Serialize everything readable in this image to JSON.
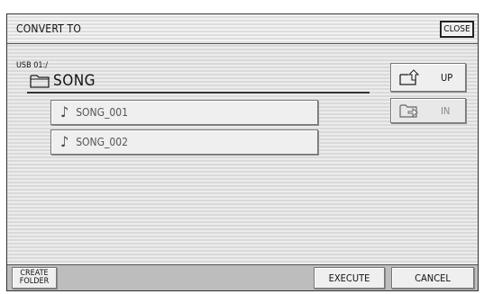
{
  "header": {
    "title": "CONVERT TO",
    "close_label": "CLOSE"
  },
  "location": {
    "device": "USB 01:/",
    "folder": "SONG"
  },
  "files": [
    {
      "name": "SONG_001"
    },
    {
      "name": "SONG_002"
    }
  ],
  "navigation": {
    "up_label": "UP",
    "in_label": "IN",
    "in_enabled": false
  },
  "footer": {
    "create_folder_line1": "CREATE",
    "create_folder_line2": "FOLDER",
    "execute_label": "EXECUTE",
    "cancel_label": "CANCEL"
  }
}
